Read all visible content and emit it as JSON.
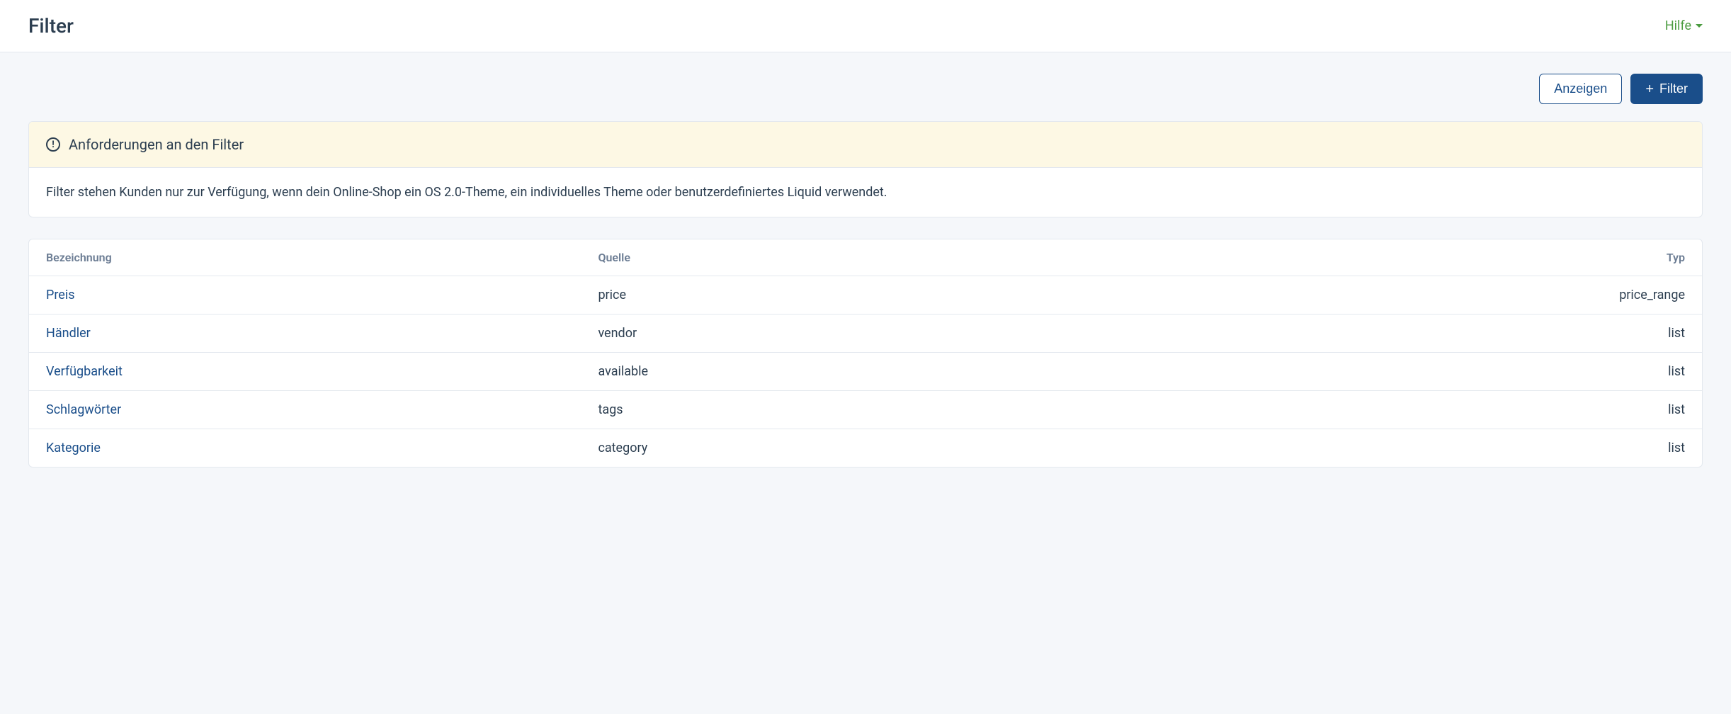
{
  "header": {
    "title": "Filter",
    "help_label": "Hilfe"
  },
  "actions": {
    "view_label": "Anzeigen",
    "add_label": "Filter"
  },
  "info_card": {
    "heading": "Anforderungen an den Filter",
    "body": "Filter stehen Kunden nur zur Verfügung, wenn dein Online-Shop ein OS 2.0-Theme, ein individuelles Theme oder benutzerdefiniertes Liquid verwendet."
  },
  "table": {
    "columns": {
      "label": "Bezeichnung",
      "source": "Quelle",
      "type": "Typ"
    },
    "rows": [
      {
        "label": "Preis",
        "source": "price",
        "type": "price_range"
      },
      {
        "label": "Händler",
        "source": "vendor",
        "type": "list"
      },
      {
        "label": "Verfügbarkeit",
        "source": "available",
        "type": "list"
      },
      {
        "label": "Schlagwörter",
        "source": "tags",
        "type": "list"
      },
      {
        "label": "Kategorie",
        "source": "category",
        "type": "list"
      }
    ]
  }
}
